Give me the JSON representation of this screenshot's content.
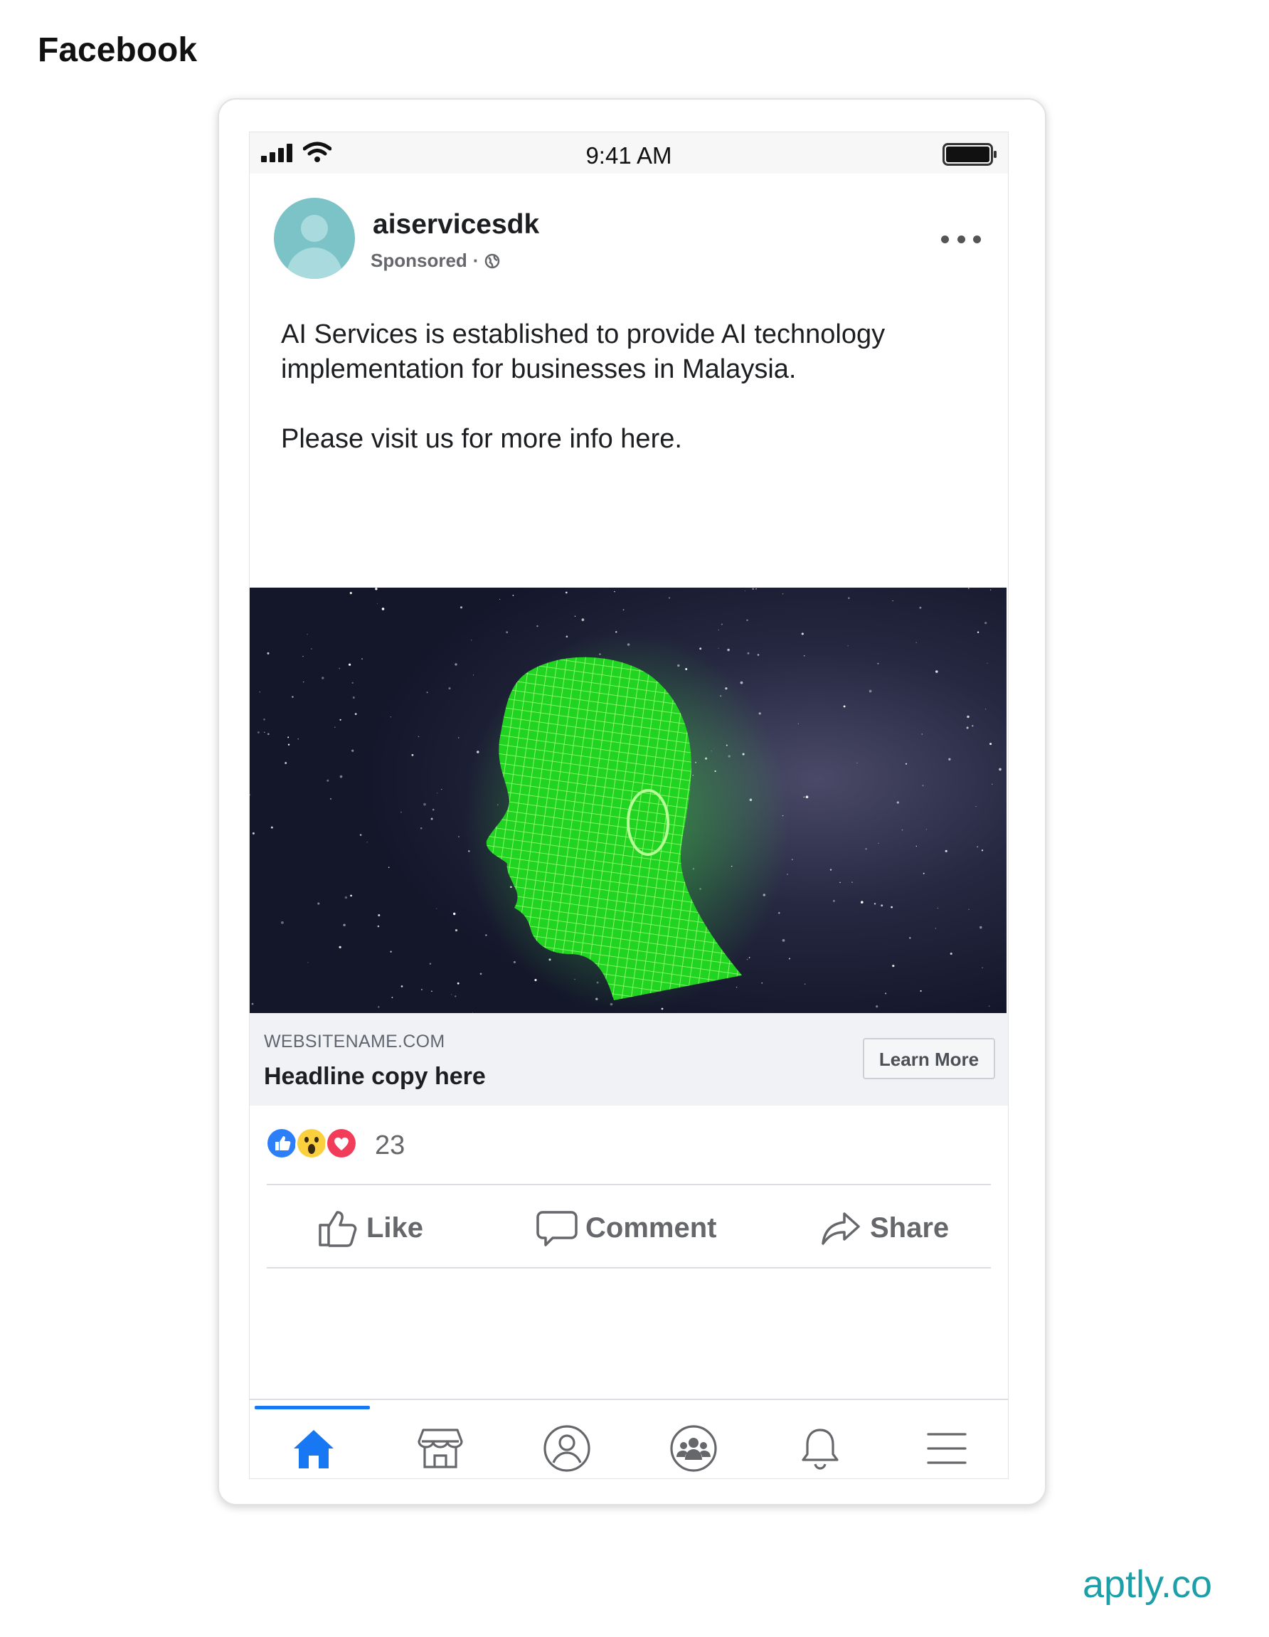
{
  "page_title": "Facebook",
  "status_bar": {
    "time": "9:41 AM"
  },
  "post": {
    "page_name": "aiservicesdk",
    "sponsored_label": "Sponsored",
    "separator": "·",
    "body_paragraphs": [
      "AI Services is established to provide AI technology implementation for businesses in Malaysia.",
      "Please visit us for more info here."
    ],
    "image_icon": "green-wireframe-head-image"
  },
  "link_preview": {
    "domain": "WEBSITENAME.COM",
    "headline": "Headline copy here",
    "cta_label": "Learn More"
  },
  "reactions": {
    "icons": [
      "like-reaction-icon",
      "wow-reaction-icon",
      "love-reaction-icon"
    ],
    "count": "23"
  },
  "actions": {
    "like_label": "Like",
    "comment_label": "Comment",
    "share_label": "Share"
  },
  "bottom_nav": {
    "items": [
      "home-icon",
      "marketplace-icon",
      "profile-icon",
      "groups-icon",
      "notifications-icon",
      "menu-icon"
    ],
    "active": "home-icon"
  },
  "colors": {
    "accent": "#1877f2",
    "link_bar_bg": "#f0f2f5",
    "footer_brand": "#1b9fa8",
    "avatar": "#7cc3c8",
    "wireframe_green": "#33ff33"
  },
  "footer": {
    "brand": "aptly.co"
  }
}
